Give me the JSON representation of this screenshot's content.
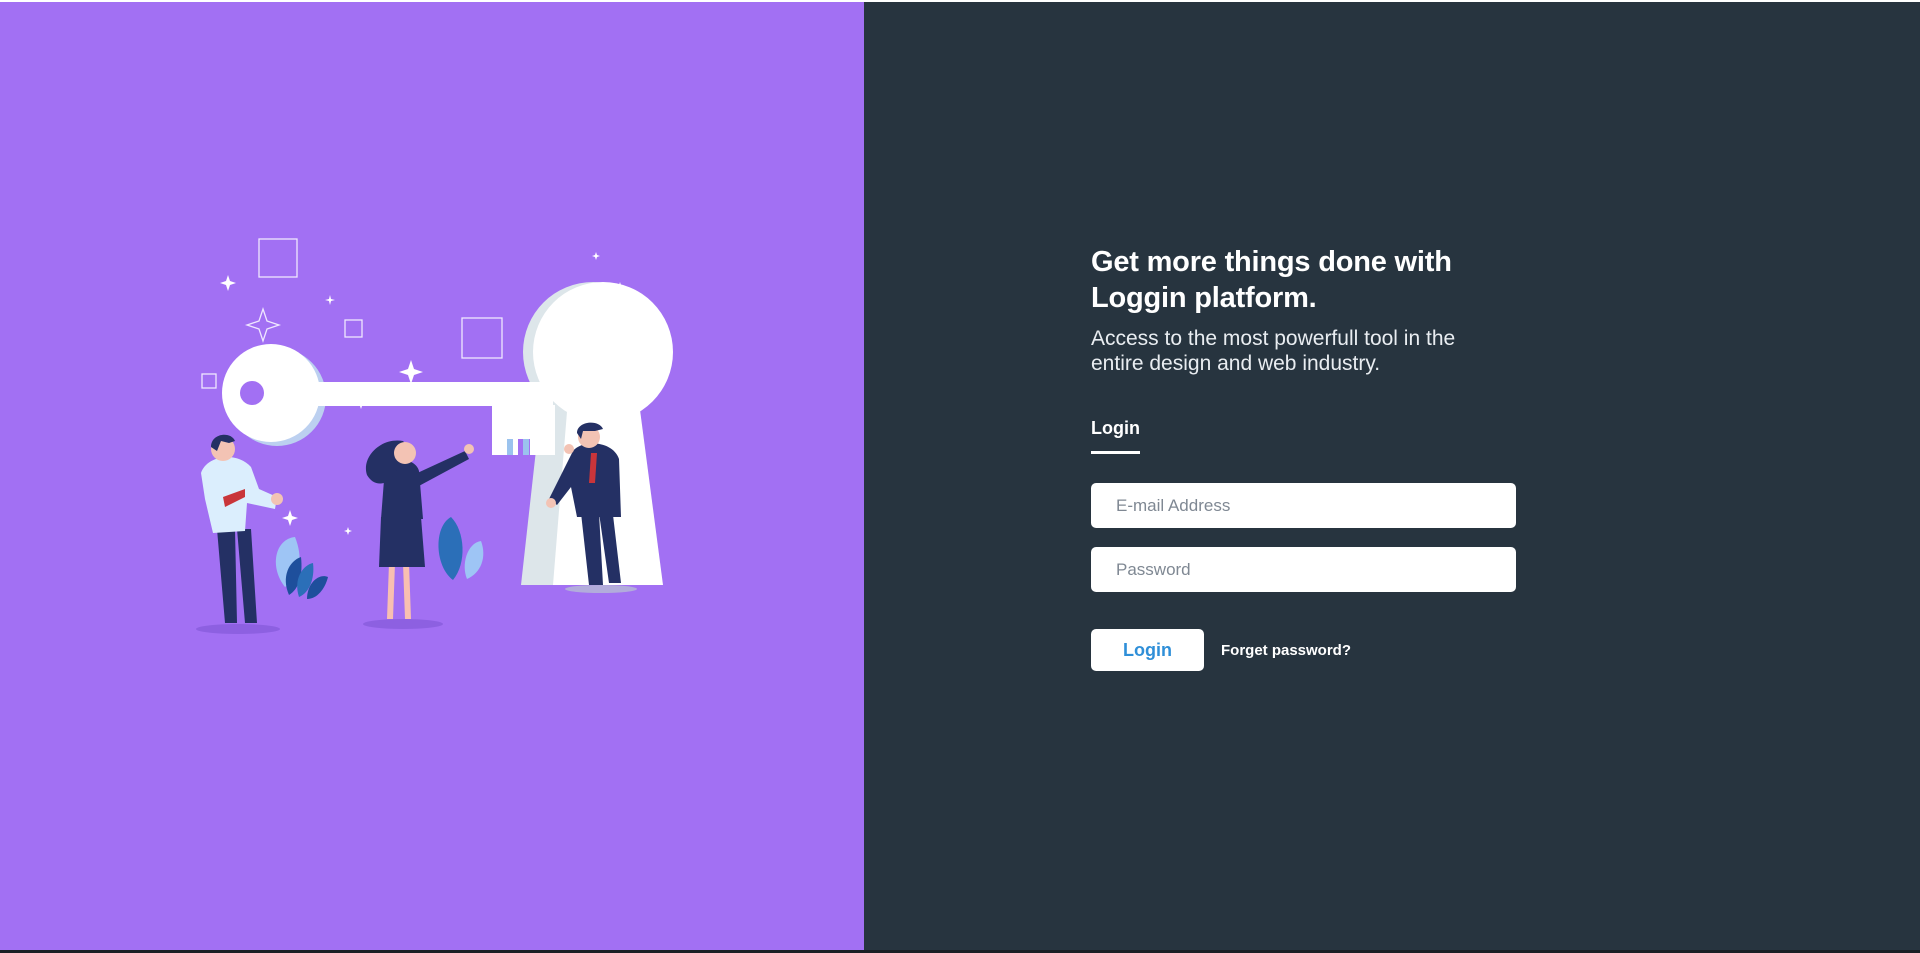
{
  "theme": {
    "left_background": "#a270f3",
    "right_background": "#27343f",
    "accent": "#2f8fd8"
  },
  "hero": {
    "illustration_icon": "key-keyhole-team-illustration"
  },
  "content": {
    "headline_line1": "Get more things done with",
    "headline_line2": "Loggin platform.",
    "subheadline": "Access to the most powerfull tool in the entire design and web industry."
  },
  "tabs": {
    "active_label": "Login"
  },
  "form": {
    "email_placeholder": "E-mail Address",
    "email_value": "",
    "password_placeholder": "Password",
    "password_value": "",
    "login_label": "Login",
    "forgot_label": "Forget password?"
  }
}
